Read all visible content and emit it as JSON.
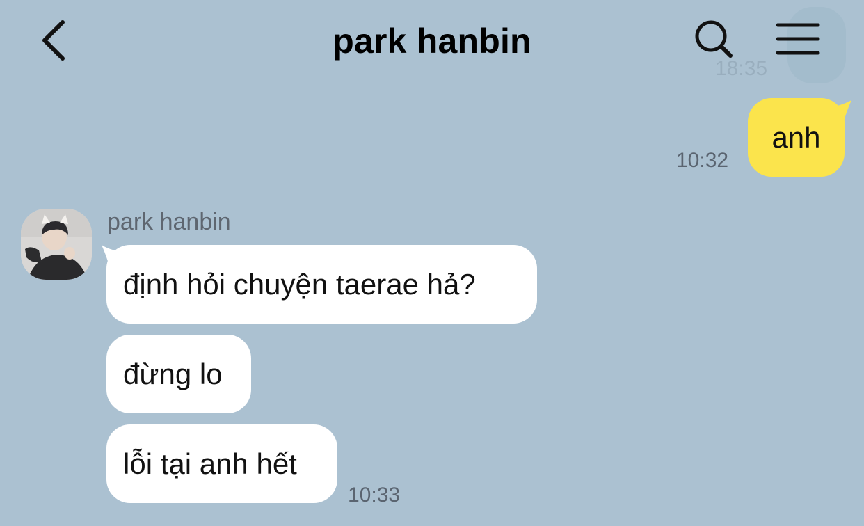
{
  "header": {
    "title": "park hanbin",
    "back_icon": "chevron-left-icon",
    "search_icon": "search-icon",
    "menu_icon": "hamburger-menu-icon",
    "ghost_time": "18:35"
  },
  "messages": {
    "sent": [
      {
        "text": "anh",
        "time": "10:32"
      }
    ],
    "received": {
      "sender_name": "park hanbin",
      "items": [
        {
          "text": "định hỏi chuyện taerae hả?"
        },
        {
          "text": "đừng lo"
        },
        {
          "text": "lỗi tại anh hết"
        }
      ],
      "time": "10:33"
    }
  },
  "colors": {
    "background": "#abc1d1",
    "sent_bubble": "#fbe44c",
    "received_bubble": "#ffffff",
    "timestamp": "#5a6470"
  }
}
